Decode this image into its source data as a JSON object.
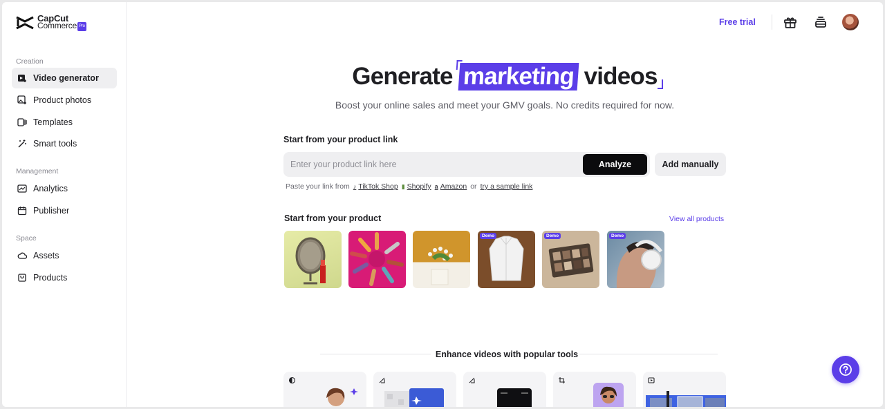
{
  "brand": {
    "line1": "CapCut",
    "line2": "Commerce",
    "badge": "Pro",
    "accent": "#5b3ee8"
  },
  "sidebar": {
    "sections": [
      {
        "label": "Creation",
        "items": [
          {
            "label": "Video generator",
            "icon": "video-plus-icon",
            "active": true
          },
          {
            "label": "Product photos",
            "icon": "image-plus-icon"
          },
          {
            "label": "Templates",
            "icon": "templates-icon"
          },
          {
            "label": "Smart tools",
            "icon": "magic-wand-icon"
          }
        ]
      },
      {
        "label": "Management",
        "items": [
          {
            "label": "Analytics",
            "icon": "analytics-icon"
          },
          {
            "label": "Publisher",
            "icon": "calendar-icon"
          }
        ]
      },
      {
        "label": "Space",
        "items": [
          {
            "label": "Assets",
            "icon": "cloud-icon"
          },
          {
            "label": "Products",
            "icon": "box-icon"
          }
        ]
      }
    ]
  },
  "topbar": {
    "free_trial": "Free trial",
    "icons": [
      "gift-icon",
      "stack-icon",
      "avatar"
    ]
  },
  "hero": {
    "title_part1": "Generate",
    "title_part2": "marketing",
    "title_part3": "videos",
    "subtitle": "Boost your online sales and meet your GMV goals. No credits required for now."
  },
  "link_section": {
    "label": "Start from your product link",
    "placeholder": "Enter your product link here",
    "analyze": "Analyze",
    "add_manually": "Add manually",
    "paste_prefix": "Paste your link from",
    "sources": [
      "TikTok Shop",
      "Shopify",
      "Amazon"
    ],
    "or": "or",
    "sample": "try a sample link"
  },
  "product_section": {
    "label": "Start from your product",
    "view_all": "View all products",
    "products": [
      {
        "name": "lipstick-mirror",
        "demo": false
      },
      {
        "name": "lipstick-circle",
        "demo": false
      },
      {
        "name": "flower-vase",
        "demo": false
      },
      {
        "name": "white-shirt",
        "demo": true,
        "badge": "Demo"
      },
      {
        "name": "eyeshadow-palette",
        "demo": true,
        "badge": "Demo"
      },
      {
        "name": "headphones-man",
        "demo": true,
        "badge": "Demo"
      }
    ]
  },
  "tools": {
    "title": "Enhance videos with popular tools",
    "cards": [
      "tool-1",
      "tool-2",
      "tool-3",
      "tool-4",
      "tool-5"
    ]
  }
}
